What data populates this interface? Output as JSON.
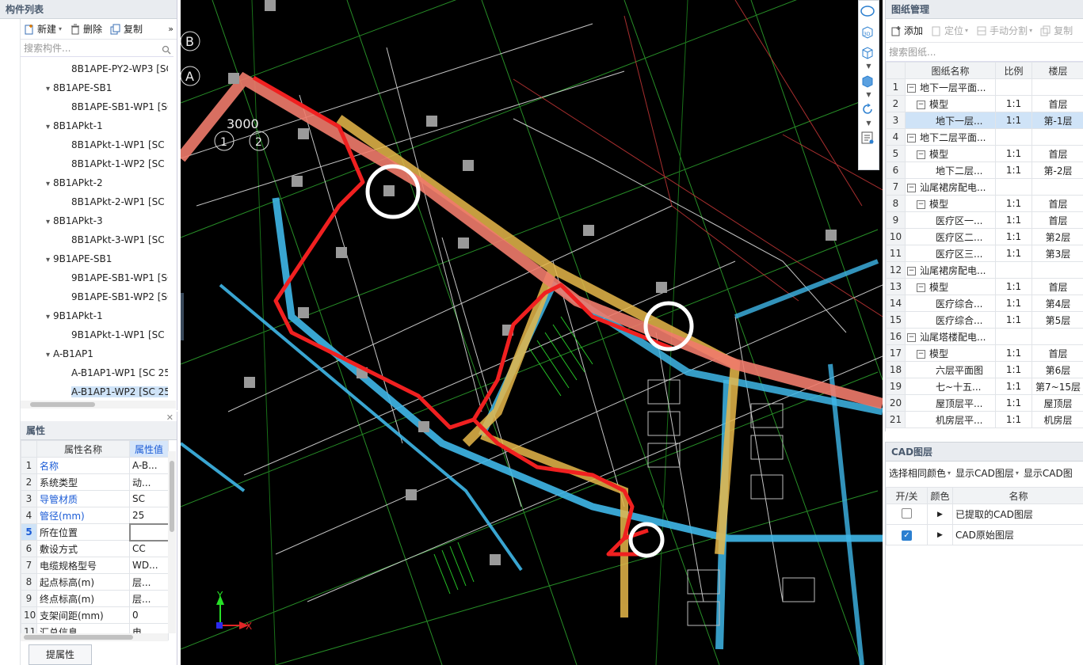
{
  "left": {
    "title": "构件列表",
    "toolbar": {
      "new": "新建",
      "delete": "删除",
      "copy": "复制",
      "more": "»"
    },
    "search_placeholder": "搜索构件...",
    "tree": [
      {
        "label": "8B1APE-PY2-WP3 [SC",
        "level": 2
      },
      {
        "label": "8B1APE-SB1",
        "level": 1
      },
      {
        "label": "8B1APE-SB1-WP1 [SC",
        "level": 2
      },
      {
        "label": "8B1APkt-1",
        "level": 1
      },
      {
        "label": "8B1APkt-1-WP1 [SC",
        "level": 2
      },
      {
        "label": "8B1APkt-1-WP2 [SC",
        "level": 2
      },
      {
        "label": "8B1APkt-2",
        "level": 1
      },
      {
        "label": "8B1APkt-2-WP1 [SC",
        "level": 2
      },
      {
        "label": "8B1APkt-3",
        "level": 1
      },
      {
        "label": "8B1APkt-3-WP1 [SC",
        "level": 2
      },
      {
        "label": "9B1APE-SB1",
        "level": 1
      },
      {
        "label": "9B1APE-SB1-WP1 [SC",
        "level": 2
      },
      {
        "label": "9B1APE-SB1-WP2 [SC",
        "level": 2
      },
      {
        "label": "9B1APkt-1",
        "level": 1
      },
      {
        "label": "9B1APkt-1-WP1 [SC",
        "level": 2
      },
      {
        "label": "A-B1AP1",
        "level": 1
      },
      {
        "label": "A-B1AP1-WP1 [SC 25",
        "level": 2
      },
      {
        "label": "A-B1AP1-WP2 [SC 25",
        "level": 2,
        "selected": true
      }
    ]
  },
  "props": {
    "title": "属性",
    "col_name": "属性名称",
    "col_value": "属性值",
    "rows": [
      {
        "n": "1",
        "name": "名称",
        "value": "A-B...",
        "blue": true
      },
      {
        "n": "2",
        "name": "系统类型",
        "value": "动...",
        "blue": false
      },
      {
        "n": "3",
        "name": "导管材质",
        "value": "SC",
        "blue": true
      },
      {
        "n": "4",
        "name": "管径(mm)",
        "value": "25",
        "blue": true
      },
      {
        "n": "5",
        "name": "所在位置",
        "value": "",
        "blue": false
      },
      {
        "n": "6",
        "name": "敷设方式",
        "value": "CC",
        "blue": false
      },
      {
        "n": "7",
        "name": "电缆规格型号",
        "value": "WD...",
        "blue": false
      },
      {
        "n": "8",
        "name": "起点标高(m)",
        "value": "层...",
        "blue": false
      },
      {
        "n": "9",
        "name": "终点标高(m)",
        "value": "层...",
        "blue": false
      },
      {
        "n": "10",
        "name": "支架间距(mm)",
        "value": "0",
        "blue": false
      },
      {
        "n": "11",
        "name": "汇总信息",
        "value": "电",
        "blue": false
      }
    ],
    "extract_button": "提属性"
  },
  "cad": {
    "labels": [
      "B",
      "A",
      "3000",
      "1",
      "2"
    ],
    "axis_x": "X",
    "axis_y": "Y"
  },
  "drawings": {
    "title": "图纸管理",
    "toolbar": {
      "add": "添加",
      "locate": "定位",
      "split": "手动分割",
      "copy": "复制"
    },
    "search_placeholder": "搜索图纸...",
    "columns": [
      "图纸名称",
      "比例",
      "楼层"
    ],
    "rows": [
      {
        "n": "1",
        "name": "地下一层平面...",
        "indent": 0,
        "ex": "−",
        "scale": "",
        "floor": ""
      },
      {
        "n": "2",
        "name": "模型",
        "indent": 1,
        "ex": "−",
        "scale": "1:1",
        "floor": "首层"
      },
      {
        "n": "3",
        "name": "地下一层...",
        "indent": 2,
        "ex": "",
        "scale": "1:1",
        "floor": "第-1层",
        "selected": true
      },
      {
        "n": "4",
        "name": "地下二层平面...",
        "indent": 0,
        "ex": "−",
        "scale": "",
        "floor": ""
      },
      {
        "n": "5",
        "name": "模型",
        "indent": 1,
        "ex": "−",
        "scale": "1:1",
        "floor": "首层"
      },
      {
        "n": "6",
        "name": "地下二层...",
        "indent": 2,
        "ex": "",
        "scale": "1:1",
        "floor": "第-2层"
      },
      {
        "n": "7",
        "name": "汕尾裙房配电...",
        "indent": 0,
        "ex": "−",
        "scale": "",
        "floor": ""
      },
      {
        "n": "8",
        "name": "模型",
        "indent": 1,
        "ex": "−",
        "scale": "1:1",
        "floor": "首层"
      },
      {
        "n": "9",
        "name": "医疗区一...",
        "indent": 2,
        "ex": "",
        "scale": "1:1",
        "floor": "首层"
      },
      {
        "n": "10",
        "name": "医疗区二...",
        "indent": 2,
        "ex": "",
        "scale": "1:1",
        "floor": "第2层"
      },
      {
        "n": "11",
        "name": "医疗区三...",
        "indent": 2,
        "ex": "",
        "scale": "1:1",
        "floor": "第3层"
      },
      {
        "n": "12",
        "name": "汕尾裙房配电...",
        "indent": 0,
        "ex": "−",
        "scale": "",
        "floor": ""
      },
      {
        "n": "13",
        "name": "模型",
        "indent": 1,
        "ex": "−",
        "scale": "1:1",
        "floor": "首层"
      },
      {
        "n": "14",
        "name": "医疗综合...",
        "indent": 2,
        "ex": "",
        "scale": "1:1",
        "floor": "第4层"
      },
      {
        "n": "15",
        "name": "医疗综合...",
        "indent": 2,
        "ex": "",
        "scale": "1:1",
        "floor": "第5层"
      },
      {
        "n": "16",
        "name": "汕尾塔楼配电...",
        "indent": 0,
        "ex": "−",
        "scale": "",
        "floor": ""
      },
      {
        "n": "17",
        "name": "模型",
        "indent": 1,
        "ex": "−",
        "scale": "1:1",
        "floor": "首层"
      },
      {
        "n": "18",
        "name": "六层平面图",
        "indent": 2,
        "ex": "",
        "scale": "1:1",
        "floor": "第6层"
      },
      {
        "n": "19",
        "name": "七~十五...",
        "indent": 2,
        "ex": "",
        "scale": "1:1",
        "floor": "第7~15层"
      },
      {
        "n": "20",
        "name": "屋顶层平...",
        "indent": 2,
        "ex": "",
        "scale": "1:1",
        "floor": "屋顶层"
      },
      {
        "n": "21",
        "name": "机房层平...",
        "indent": 2,
        "ex": "",
        "scale": "1:1",
        "floor": "机房层"
      }
    ]
  },
  "layers": {
    "title": "CAD图层",
    "toolbar": {
      "same_color": "选择相同颜色",
      "show_layer": "显示CAD图层",
      "show_layer2": "显示CAD图"
    },
    "columns": [
      "开/关",
      "颜色",
      "名称"
    ],
    "rows": [
      {
        "checked": false,
        "name": "已提取的CAD图层"
      },
      {
        "checked": true,
        "name": "CAD原始图层"
      }
    ]
  }
}
